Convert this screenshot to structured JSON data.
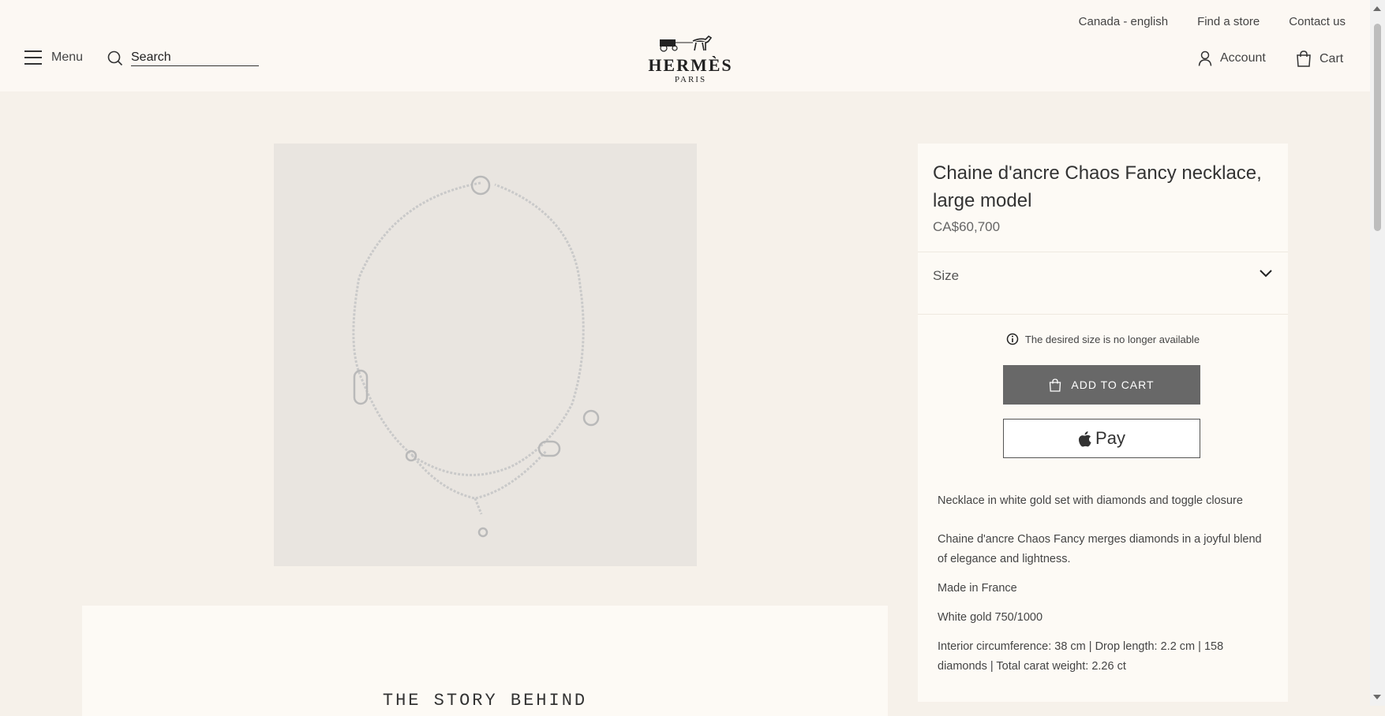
{
  "header": {
    "top_links": [
      "Canada - english",
      "Find a store",
      "Contact us"
    ],
    "menu_label": "Menu",
    "search_label": "Search",
    "logo_brand": "HERMÈS",
    "logo_city": "PARIS",
    "account_label": "Account",
    "cart_label": "Cart"
  },
  "product": {
    "title": "Chaine d'ancre Chaos Fancy necklace, large model",
    "price": "CA$60,700",
    "size_label": "Size",
    "notice": "The desired size is no longer available",
    "add_to_cart": "ADD TO CART",
    "apple_pay": "Pay",
    "details": [
      "Necklace in white gold set with diamonds and toggle closure",
      "Chaine d'ancre Chaos Fancy merges diamonds in a joyful blend of elegance and lightness.",
      "Made in France",
      "White gold 750/1000",
      "Interior circumference: 38 cm | Drop length: 2.2 cm | 158 diamonds | Total carat weight: 2.26 ct"
    ]
  },
  "story": {
    "title": "THE STORY BEHIND"
  },
  "colors": {
    "background": "#f6f1ea",
    "header": "#fcf8f3",
    "button": "#686868"
  }
}
